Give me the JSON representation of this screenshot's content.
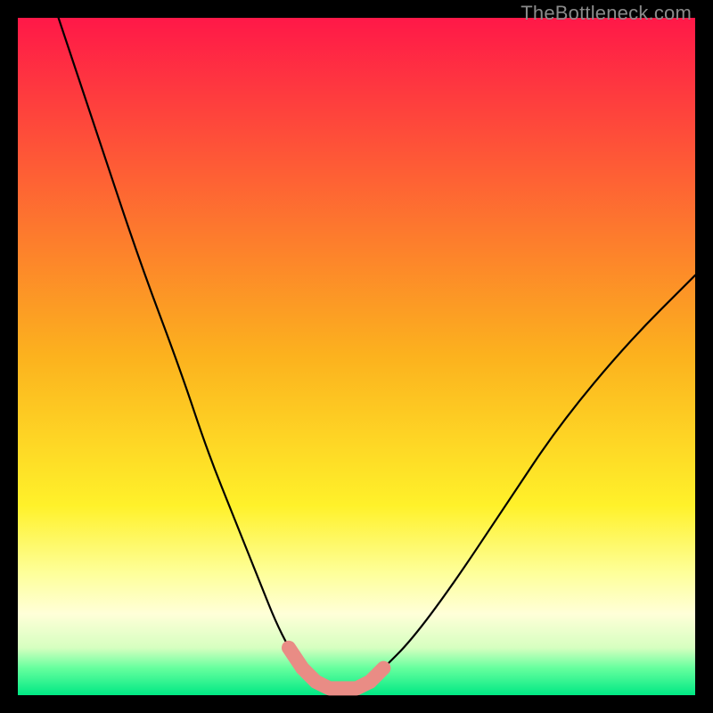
{
  "watermark": "TheBottleneck.com",
  "chart_data": {
    "type": "line",
    "title": "",
    "xlabel": "",
    "ylabel": "",
    "xlim": [
      0,
      100
    ],
    "ylim": [
      0,
      100
    ],
    "grid": false,
    "legend": null,
    "series": [
      {
        "name": "bottleneck-curve",
        "x": [
          6,
          12,
          18,
          24,
          28,
          32,
          36,
          38,
          40,
          42,
          44,
          46,
          48,
          50,
          52,
          54,
          58,
          64,
          72,
          80,
          90,
          100
        ],
        "y": [
          100,
          82,
          64,
          48,
          36,
          26,
          16,
          11,
          7,
          4,
          2,
          1,
          1,
          1,
          2,
          4,
          8,
          16,
          28,
          40,
          52,
          62
        ]
      }
    ],
    "annotations": [
      {
        "name": "valley-highlight",
        "x_range": [
          40,
          54
        ],
        "color": "#e98c85"
      }
    ],
    "background_gradient": {
      "stops": [
        {
          "offset": 0.0,
          "color": "#ff1848"
        },
        {
          "offset": 0.5,
          "color": "#fcb21e"
        },
        {
          "offset": 0.72,
          "color": "#fff12a"
        },
        {
          "offset": 0.82,
          "color": "#feff9a"
        },
        {
          "offset": 0.88,
          "color": "#ffffd8"
        },
        {
          "offset": 0.93,
          "color": "#d6ffc0"
        },
        {
          "offset": 0.96,
          "color": "#66ff9e"
        },
        {
          "offset": 1.0,
          "color": "#00e884"
        }
      ]
    }
  }
}
